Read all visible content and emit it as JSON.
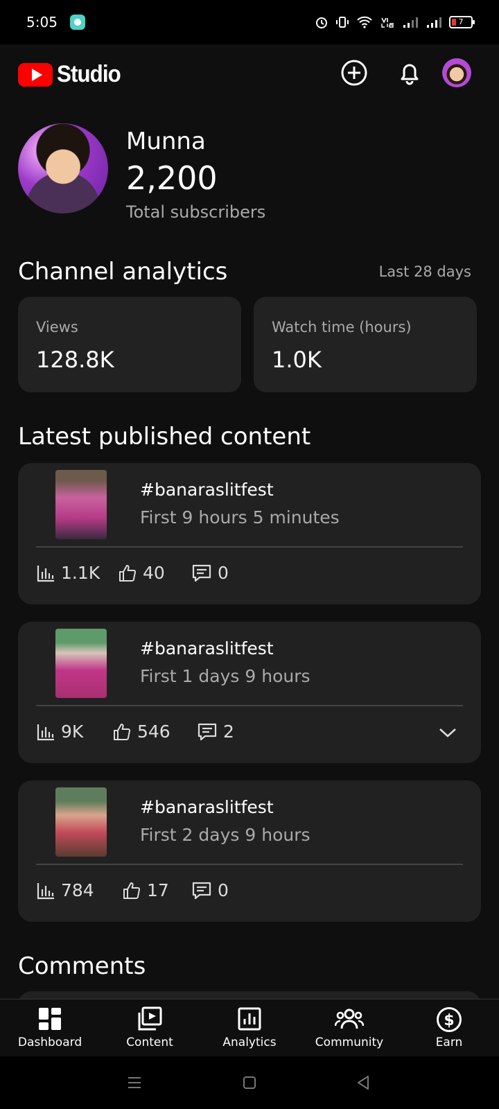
{
  "status_bar": {
    "time": "5:05",
    "battery": "7"
  },
  "header": {
    "app_name": "Studio"
  },
  "profile": {
    "name": "Munna",
    "subscribers": "2,200",
    "subscribers_label": "Total subscribers"
  },
  "analytics": {
    "title": "Channel analytics",
    "period": "Last 28 days",
    "views_label": "Views",
    "views_value": "128.8K",
    "watch_label": "Watch time (hours)",
    "watch_value": "1.0K"
  },
  "latest": {
    "title": "Latest published content",
    "items": [
      {
        "title": "#banaraslitfest",
        "subtitle": "First 9 hours 5 minutes",
        "views": "1.1K",
        "likes": "40",
        "comments": "0"
      },
      {
        "title": "#banaraslitfest",
        "subtitle": "First 1 days 9 hours",
        "views": "9K",
        "likes": "546",
        "comments": "2"
      },
      {
        "title": "#banaraslitfest",
        "subtitle": "First 2 days 9 hours",
        "views": "784",
        "likes": "17",
        "comments": "0"
      }
    ]
  },
  "comments": {
    "title": "Comments"
  },
  "bottom_nav": [
    {
      "label": "Dashboard",
      "icon": "dashboard-icon"
    },
    {
      "label": "Content",
      "icon": "content-icon"
    },
    {
      "label": "Analytics",
      "icon": "analytics-icon"
    },
    {
      "label": "Community",
      "icon": "community-icon"
    },
    {
      "label": "Earn",
      "icon": "earn-icon"
    }
  ]
}
